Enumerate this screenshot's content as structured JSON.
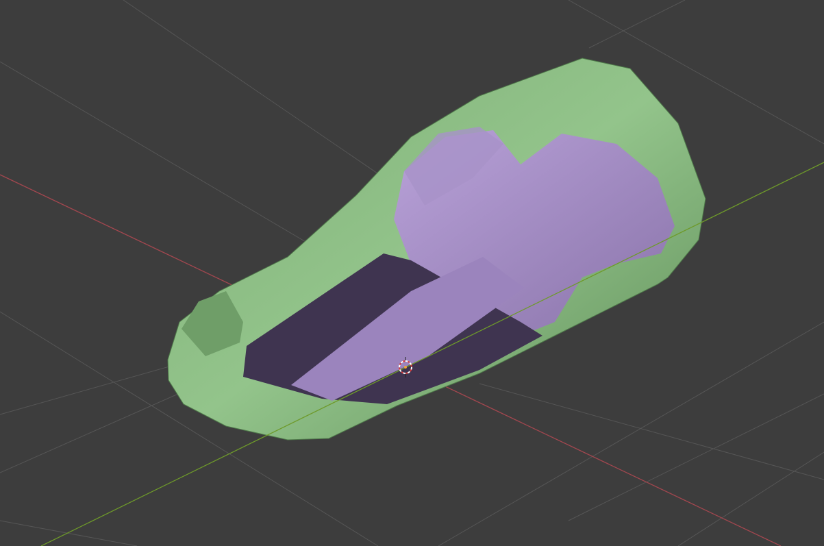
{
  "viewport": {
    "background": "#3d3d3d",
    "grid_color": "#555555",
    "x_axis_color": "#a3474f",
    "y_axis_color": "#6e9a2a",
    "body_color": "#8fbf86",
    "interior_color": "#a892c8",
    "floor_color": "#3f3450",
    "cursor_colors": [
      "#d83a3a",
      "#ffffff"
    ]
  }
}
